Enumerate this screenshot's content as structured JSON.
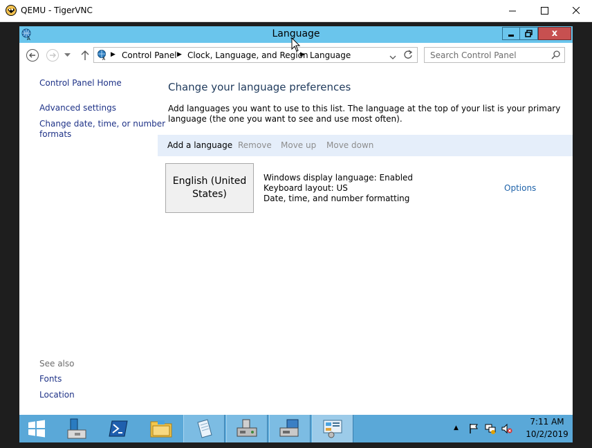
{
  "vnc": {
    "title": "QEMU - TigerVNC",
    "icon": "tigervnc-icon"
  },
  "window": {
    "title": "Language",
    "icon": "language-icon",
    "close_label": "x"
  },
  "nav": {
    "breadcrumbs": [
      "Control Panel",
      "Clock, Language, and Region",
      "Language"
    ],
    "search_placeholder": "Search Control Panel"
  },
  "left_pane": {
    "home": "Control Panel Home",
    "advanced": "Advanced settings",
    "change_date_line1": "Change date, time, or number",
    "change_date_line2": "formats",
    "see_also": "See also",
    "fonts": "Fonts",
    "location": "Location"
  },
  "main": {
    "heading": "Change your language preferences",
    "description": "Add languages you want to use to this list. The language at the top of your list is your primary language (the one you want to see and use most often).",
    "toolbar": {
      "add": "Add a language",
      "remove": "Remove",
      "move_up": "Move up",
      "move_down": "Move down"
    },
    "language": {
      "name_line1": "English (United",
      "name_line2": "States)",
      "display": "Windows display language: Enabled",
      "keyboard": "Keyboard layout: US",
      "formatting": "Date, time, and number formatting",
      "options": "Options"
    }
  },
  "taskbar": {
    "time": "7:11 AM",
    "date": "10/2/2019",
    "tray_up": "▲"
  },
  "colors": {
    "titlebar": "#6ac5ec",
    "taskbar": "#5aa8d8",
    "link": "#1e3287",
    "heading": "#1e395b",
    "toolbar_bg": "#e5eefa",
    "close": "#c75050"
  }
}
